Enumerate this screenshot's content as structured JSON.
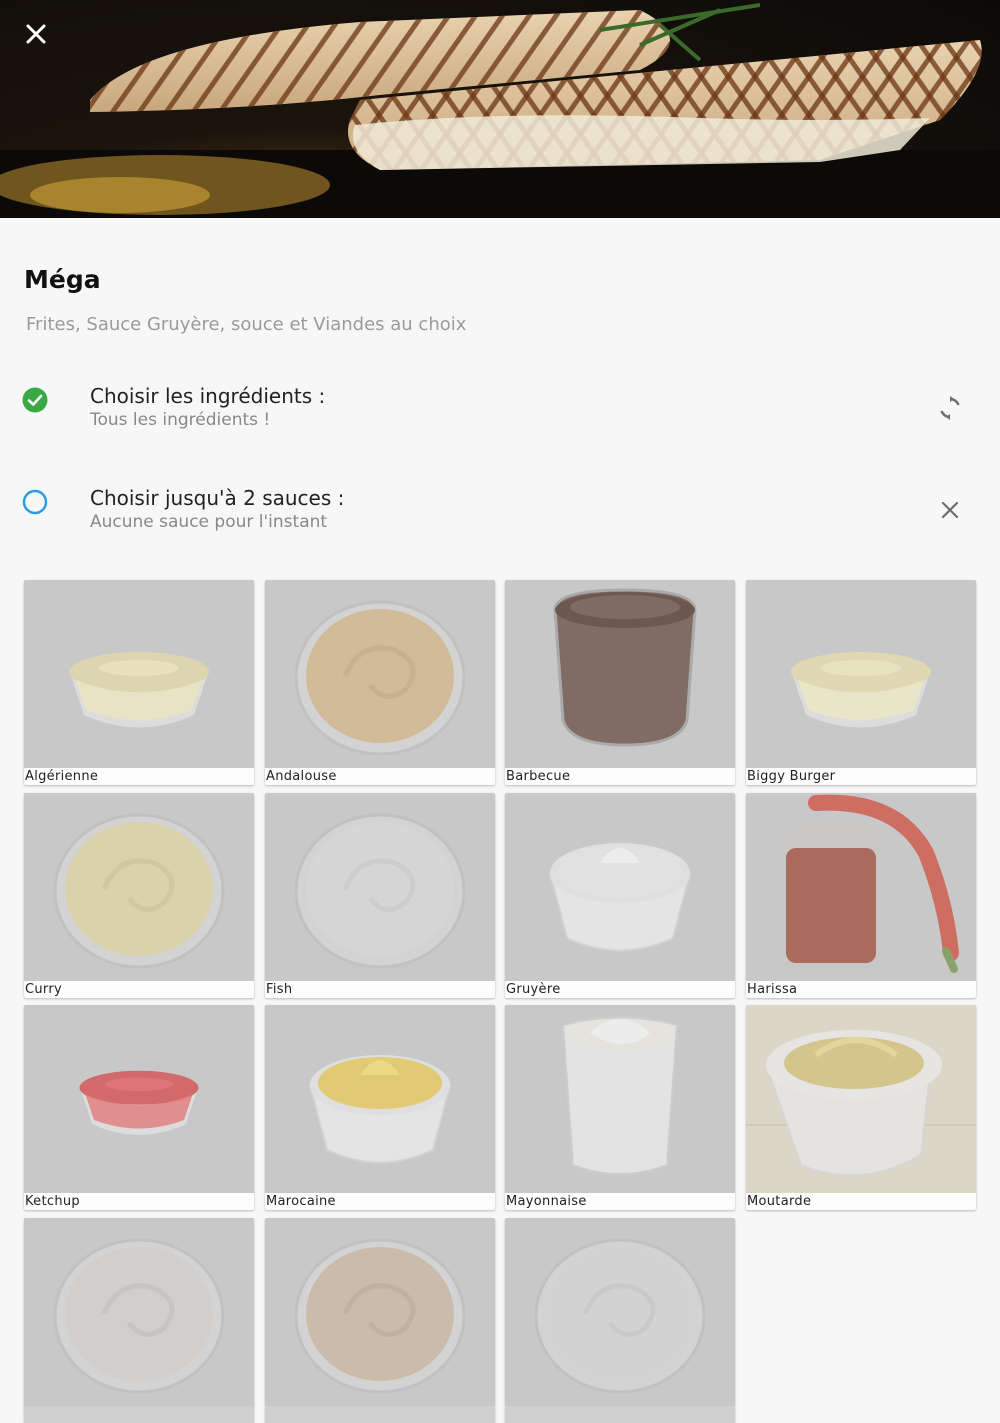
{
  "product": {
    "title": "Méga",
    "description": "Frites, Sauce Gruyère, souce et Viandes au choix"
  },
  "steps": [
    {
      "heading": "Choisir les ingrédients :",
      "sub": "Tous les ingrédients !",
      "status": "done",
      "action": "refresh-icon"
    },
    {
      "heading": "Choisir jusqu'à 2 sauces :",
      "sub": "Aucune sauce pour l'instant",
      "status": "pending",
      "action": "close-icon"
    }
  ],
  "sauces": [
    {
      "label": "Algérienne",
      "sauce_color": "#e9dca4",
      "container": "glass-bowl"
    },
    {
      "label": "Andalouse",
      "sauce_color": "#d8b47e",
      "container": "top-dish"
    },
    {
      "label": "Barbecue",
      "sauce_color": "#5a3a30",
      "container": "jar"
    },
    {
      "label": "Biggy Burger",
      "sauce_color": "#ece0a8",
      "container": "glass-bowl"
    },
    {
      "label": "Curry",
      "sauce_color": "#e3d79a",
      "container": "top-dish"
    },
    {
      "label": "Fish",
      "sauce_color": "#dedede",
      "container": "top-dish"
    },
    {
      "label": "Gruyère",
      "sauce_color": "#eeeeee",
      "container": "white-bowl"
    },
    {
      "label": "Harissa",
      "sauce_color": "#9a3a26",
      "container": "jar-chili"
    },
    {
      "label": "Ketchup",
      "sauce_color": "#d8383a",
      "container": "glass-bowl-small"
    },
    {
      "label": "Marocaine",
      "sauce_color": "#f0c947",
      "container": "white-bowl"
    },
    {
      "label": "Mayonnaise",
      "sauce_color": "#f4f2ea",
      "container": "tall-cup"
    },
    {
      "label": "Moutarde",
      "sauce_color": "#d9c46a",
      "container": "mustard-bowl"
    },
    {
      "label": "",
      "sauce_color": "#d6d2cc",
      "container": "top-dish"
    },
    {
      "label": "",
      "sauce_color": "#cbb49c",
      "container": "top-dish"
    },
    {
      "label": "",
      "sauce_color": "#d8d8d8",
      "container": "top-dish"
    }
  ],
  "colors": {
    "check_green": "#3aa845",
    "pending_blue": "#2b9be0",
    "icon_grey": "#6f6f6f"
  }
}
